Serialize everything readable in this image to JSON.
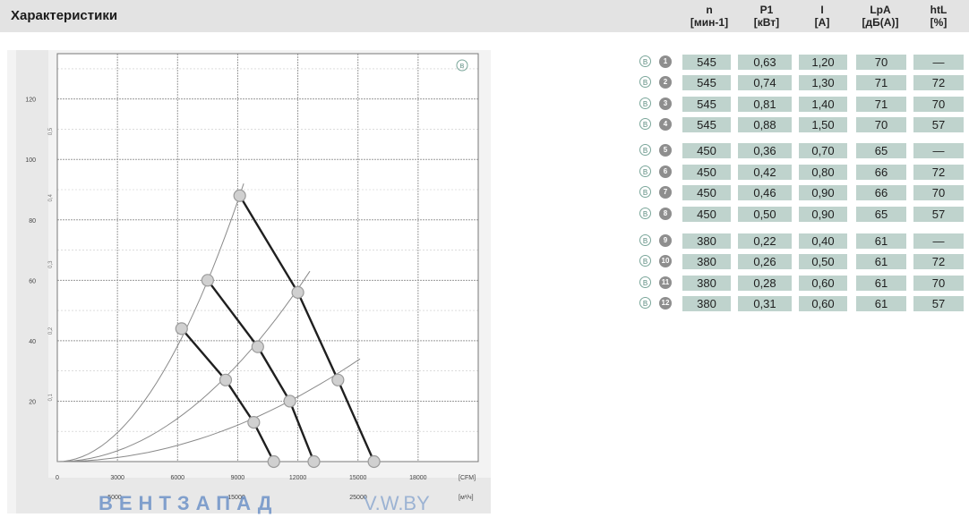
{
  "header": {
    "title": "Характеристики",
    "columns": [
      {
        "label": "n",
        "unit": "[мин-1]"
      },
      {
        "label": "P1",
        "unit": "[кВт]"
      },
      {
        "label": "I",
        "unit": "[A]"
      },
      {
        "label": "LpA",
        "unit": "[дБ(A)]"
      },
      {
        "label": "htL",
        "unit": "[%]"
      }
    ]
  },
  "table": {
    "marker": "B",
    "rows": [
      {
        "id": "1",
        "n": "545",
        "p1": "0,63",
        "i": "1,20",
        "lpa": "70",
        "eff": "—"
      },
      {
        "id": "2",
        "n": "545",
        "p1": "0,74",
        "i": "1,30",
        "lpa": "71",
        "eff": "72"
      },
      {
        "id": "3",
        "n": "545",
        "p1": "0,81",
        "i": "1,40",
        "lpa": "71",
        "eff": "70"
      },
      {
        "id": "4",
        "n": "545",
        "p1": "0,88",
        "i": "1,50",
        "lpa": "70",
        "eff": "57"
      },
      {
        "id": "5",
        "n": "450",
        "p1": "0,36",
        "i": "0,70",
        "lpa": "65",
        "eff": "—"
      },
      {
        "id": "6",
        "n": "450",
        "p1": "0,42",
        "i": "0,80",
        "lpa": "66",
        "eff": "72"
      },
      {
        "id": "7",
        "n": "450",
        "p1": "0,46",
        "i": "0,90",
        "lpa": "66",
        "eff": "70"
      },
      {
        "id": "8",
        "n": "450",
        "p1": "0,50",
        "i": "0,90",
        "lpa": "65",
        "eff": "57"
      },
      {
        "id": "9",
        "n": "380",
        "p1": "0,22",
        "i": "0,40",
        "lpa": "61",
        "eff": "—"
      },
      {
        "id": "10",
        "n": "380",
        "p1": "0,26",
        "i": "0,50",
        "lpa": "61",
        "eff": "72"
      },
      {
        "id": "11",
        "n": "380",
        "p1": "0,28",
        "i": "0,60",
        "lpa": "61",
        "eff": "70"
      },
      {
        "id": "12",
        "n": "380",
        "p1": "0,31",
        "i": "0,60",
        "lpa": "61",
        "eff": "57"
      }
    ]
  },
  "chart_data": {
    "type": "line",
    "marker": "B",
    "x_ticks": [
      "0",
      "3000",
      "6000",
      "9000",
      "12000",
      "15000",
      "18000"
    ],
    "x_unit": "[CFM]",
    "x2_ticks": [
      "5000",
      "15000",
      "25000"
    ],
    "x2_unit": "[м³/ч]",
    "y_ticks": [
      "20",
      "40",
      "60",
      "80",
      "100",
      "120"
    ],
    "y_ticks_right": [
      "0,1",
      "0,2",
      "0,3",
      "0,4",
      "0,5"
    ],
    "xlim": [
      0,
      21000
    ],
    "ylim": [
      0,
      135
    ],
    "series": [
      {
        "x": [
          6200,
          8400,
          9800,
          10800
        ],
        "y": [
          44,
          27,
          13,
          0
        ]
      },
      {
        "x": [
          7500,
          10000,
          11600,
          12800
        ],
        "y": [
          60,
          38,
          20,
          0
        ]
      },
      {
        "x": [
          9100,
          12000,
          14000,
          15800
        ],
        "y": [
          88,
          56,
          27,
          0
        ]
      }
    ],
    "parabolas": [
      {
        "x_end": 9300,
        "y_end": 92
      },
      {
        "x_end": 12600,
        "y_end": 63
      },
      {
        "x_end": 15100,
        "y_end": 34
      }
    ],
    "watermark": "ВЕНТЗАПАД",
    "watermark_suffix": "V.W.BY"
  }
}
